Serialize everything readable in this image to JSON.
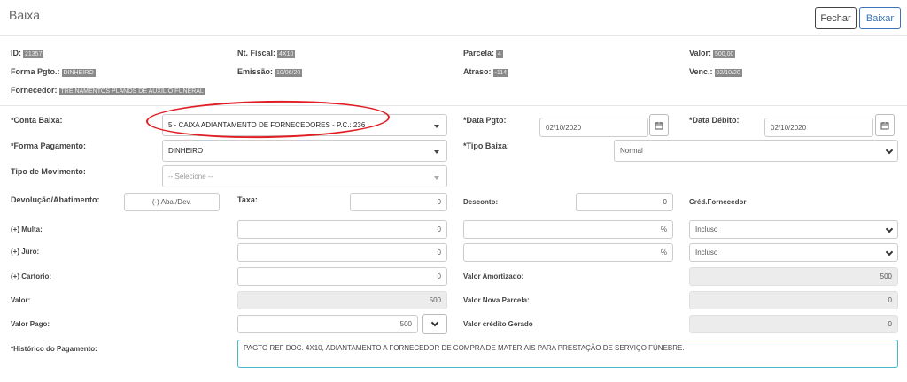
{
  "header": {
    "title": "Baixa",
    "close_label": "Fechar",
    "submit_label": "Baixar"
  },
  "info": {
    "id_label": "ID:",
    "id_value": "21357",
    "nf_label": "Nt. Fiscal:",
    "nf_value": "4X10",
    "parcela_label": "Parcela:",
    "parcela_value": "4",
    "valor_label": "Valor:",
    "valor_value": "500,00",
    "forma_label": "Forma Pgto.:",
    "forma_value": "DINHEIRO",
    "emissao_label": "Emissão:",
    "emissao_value": "10/06/20",
    "atraso_label": "Atraso:",
    "atraso_value": "-114",
    "venc_label": "Venc.:",
    "venc_value": "02/10/20",
    "fornecedor_label": "Fornecedor:",
    "fornecedor_value": "TREINAMENTOS PLANOS DE AUXILIO FUNERAL"
  },
  "form": {
    "conta_label": "*Conta Baixa:",
    "conta_value": "5 - CAIXA ADIANTAMENTO DE FORNECEDORES - P.C.: 236",
    "data_pgto_label": "*Data Pgto:",
    "data_pgto_value": "02/10/2020",
    "data_debito_label": "*Data Débito:",
    "data_debito_value": "02/10/2020",
    "forma_pag_label": "*Forma Pagamento:",
    "forma_pag_value": "DINHEIRO",
    "tipo_baixa_label": "*Tipo Baixa:",
    "tipo_baixa_value": "Normal",
    "tipo_mov_label": "Tipo de Movimento:",
    "tipo_mov_placeholder": "-- Selecione --",
    "devolucao_label": "Devolução/Abatimento:",
    "devolucao_value": "(-) Aba./Dev.",
    "taxa_label": "Taxa:",
    "taxa_value": "0",
    "desconto_label": "Desconto:",
    "desconto_value": "0",
    "cred_label": "Créd.Fornecedor",
    "multa_label": "(+) Multa:",
    "multa_value": "0",
    "multa_pct": "%",
    "multa_sel": "Incluso",
    "juro_label": "(+) Juro:",
    "juro_value": "0",
    "juro_pct": "%",
    "juro_sel": "Incluso",
    "cartorio_label": "(+) Cartorio:",
    "cartorio_value": "0",
    "amortizado_label": "Valor Amortizado:",
    "amortizado_value": "500",
    "valor_label": "Valor:",
    "valor_value": "500",
    "nova_parcela_label": "Valor Nova Parcela:",
    "nova_parcela_value": "0",
    "valor_pago_label": "Valor Pago:",
    "valor_pago_value": "500",
    "credito_label": "Valor crédito Gerado",
    "credito_value": "0",
    "historico_label": "*Histórico do Pagamento:",
    "historico_value": "PAGTO REF DOC. 4X10, ADIANTAMENTO A FORNECEDOR DE COMPRA DE MATERIAIS PARA PRESTAÇÃO DE SERVIÇO FÚNEBRE."
  },
  "colors": {
    "accent": "#3b73b9",
    "highlight": "#e01e24",
    "textarea_border": "#48b8c8"
  }
}
